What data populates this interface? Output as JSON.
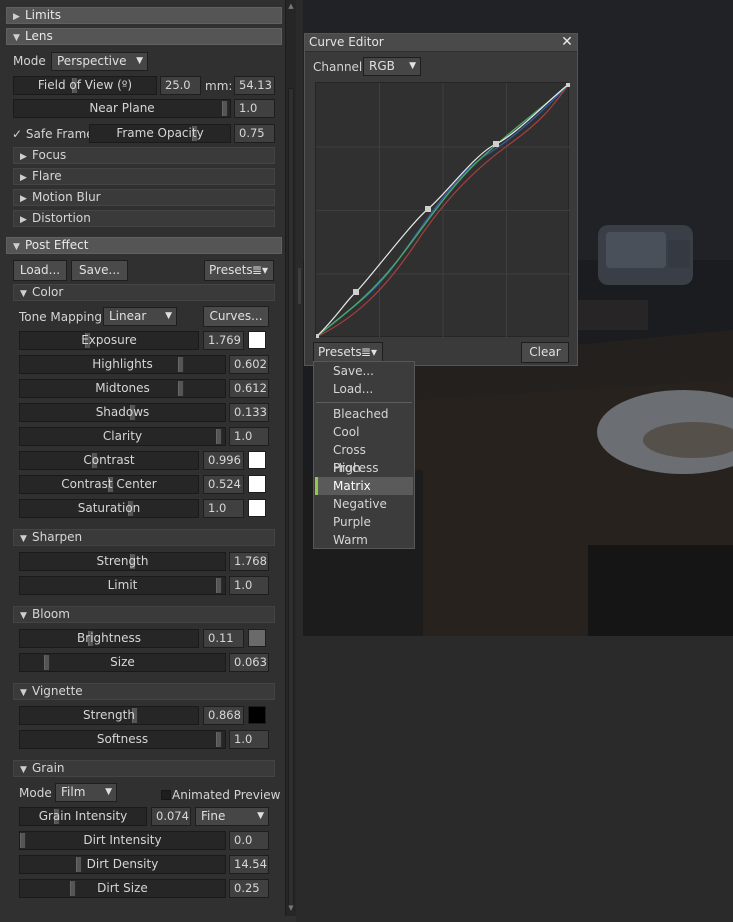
{
  "lens_panel": {
    "limits_header": "Limits",
    "lens_header": "Lens",
    "mode_label": "Mode",
    "mode_value": "Perspective",
    "fov_label": "Field of View (º)",
    "fov_value": "25.0",
    "mm_label": "mm:",
    "mm_value": "54.13",
    "near_plane_label": "Near Plane",
    "near_plane_value": "1.0",
    "safe_frame_label": "Safe Frame",
    "frame_opacity_label": "Frame Opacity",
    "frame_opacity_value": "0.75",
    "focus_label": "Focus",
    "flare_label": "Flare",
    "motion_blur_label": "Motion Blur",
    "distortion_label": "Distortion"
  },
  "post_effect": {
    "header": "Post Effect",
    "load_label": "Load...",
    "save_label": "Save...",
    "presets_label": "Presets",
    "color": {
      "header": "Color",
      "tone_mapping_label": "Tone Mapping",
      "tone_mapping_value": "Linear",
      "curves_label": "Curves...",
      "exposure_label": "Exposure",
      "exposure_value": "1.769",
      "highlights_label": "Highlights",
      "highlights_value": "0.602",
      "midtones_label": "Midtones",
      "midtones_value": "0.612",
      "shadows_label": "Shadows",
      "shadows_value": "0.133",
      "clarity_label": "Clarity",
      "clarity_value": "1.0",
      "contrast_label": "Contrast",
      "contrast_value": "0.996",
      "contrast_center_label": "Contrast Center",
      "contrast_center_value": "0.524",
      "saturation_label": "Saturation",
      "saturation_value": "1.0"
    },
    "sharpen": {
      "header": "Sharpen",
      "strength_label": "Strength",
      "strength_value": "1.768",
      "limit_label": "Limit",
      "limit_value": "1.0"
    },
    "bloom": {
      "header": "Bloom",
      "brightness_label": "Brightness",
      "brightness_value": "0.11",
      "size_label": "Size",
      "size_value": "0.063"
    },
    "vignette": {
      "header": "Vignette",
      "strength_label": "Strength",
      "strength_value": "0.868",
      "softness_label": "Softness",
      "softness_value": "1.0"
    },
    "grain": {
      "header": "Grain",
      "mode_label": "Mode",
      "mode_value": "Film",
      "animated_preview_label": "Animated Preview",
      "grain_intensity_label": "Grain Intensity",
      "grain_intensity_value": "0.074",
      "grain_type_value": "Fine",
      "dirt_intensity_label": "Dirt Intensity",
      "dirt_intensity_value": "0.0",
      "dirt_density_label": "Dirt Density",
      "dirt_density_value": "14.54",
      "dirt_size_label": "Dirt Size",
      "dirt_size_value": "0.25"
    }
  },
  "curve_editor": {
    "title": "Curve Editor",
    "channel_label": "Channel",
    "channel_value": "RGB",
    "presets_label": "Presets",
    "clear_label": "Clear"
  },
  "preset_menu": {
    "actions": [
      "Save...",
      "Load..."
    ],
    "presets": [
      "Bleached",
      "Cool",
      "Cross Process",
      "High Contrast",
      "Matrix",
      "Negative",
      "Purple",
      "Warm"
    ],
    "selected": "Matrix"
  },
  "colors": {
    "accent_selected": "#8fc84a",
    "curve_rgb": "#e8e8e8",
    "curve_green": "#4aa86a",
    "curve_red": "#b04848",
    "curve_blue": "#4a6ab8"
  }
}
